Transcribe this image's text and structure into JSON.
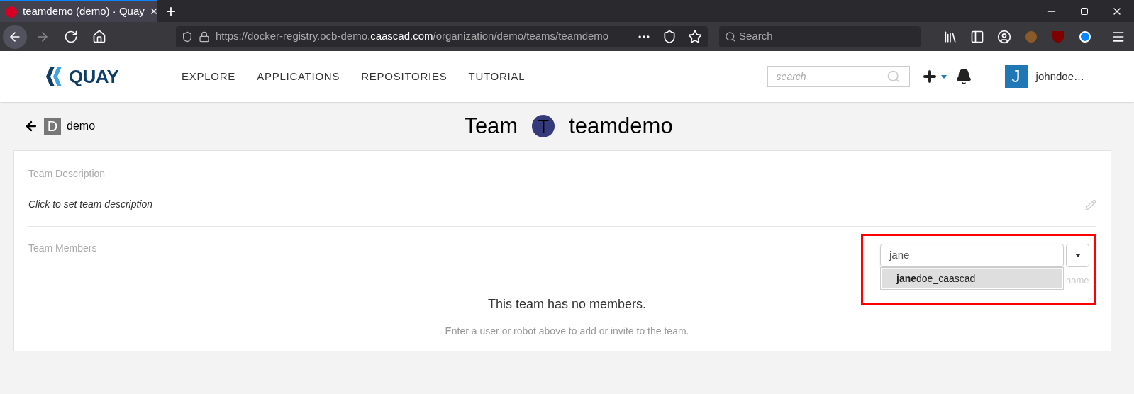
{
  "browser": {
    "tabs": [
      {
        "title": "teamdemo (demo) · Quay",
        "close": "×",
        "selected": true
      }
    ],
    "new_tab": "+",
    "url": {
      "prefix": "https://docker-registry.ocb-demo.",
      "domain": "caascad.com",
      "path": "/organization/demo/teams/teamdemo"
    },
    "search": {
      "placeholder": "Search"
    }
  },
  "header": {
    "logo": "QUAY",
    "nav": [
      "EXPLORE",
      "APPLICATIONS",
      "REPOSITORIES",
      "TUTORIAL"
    ],
    "search": {
      "placeholder": "search"
    },
    "user": {
      "initial": "J",
      "name": "johndoe…"
    }
  },
  "breadcrumb": {
    "initial": "D",
    "name": "demo"
  },
  "title": {
    "label": "Team",
    "initial": "T",
    "name": "teamdemo"
  },
  "description": {
    "heading": "Team Description",
    "text": "Click to set team description"
  },
  "members": {
    "heading": "Team Members",
    "empty_title": "This team has no members.",
    "empty_hint": "Enter a user or robot above to add or invite to the team.",
    "entity_search": {
      "value": "jane",
      "highlighted": true,
      "suggestions": [
        {
          "text": "**jane**doe_caascad",
          "selected": true
        }
      ],
      "hint_fragment": "name"
    }
  }
}
